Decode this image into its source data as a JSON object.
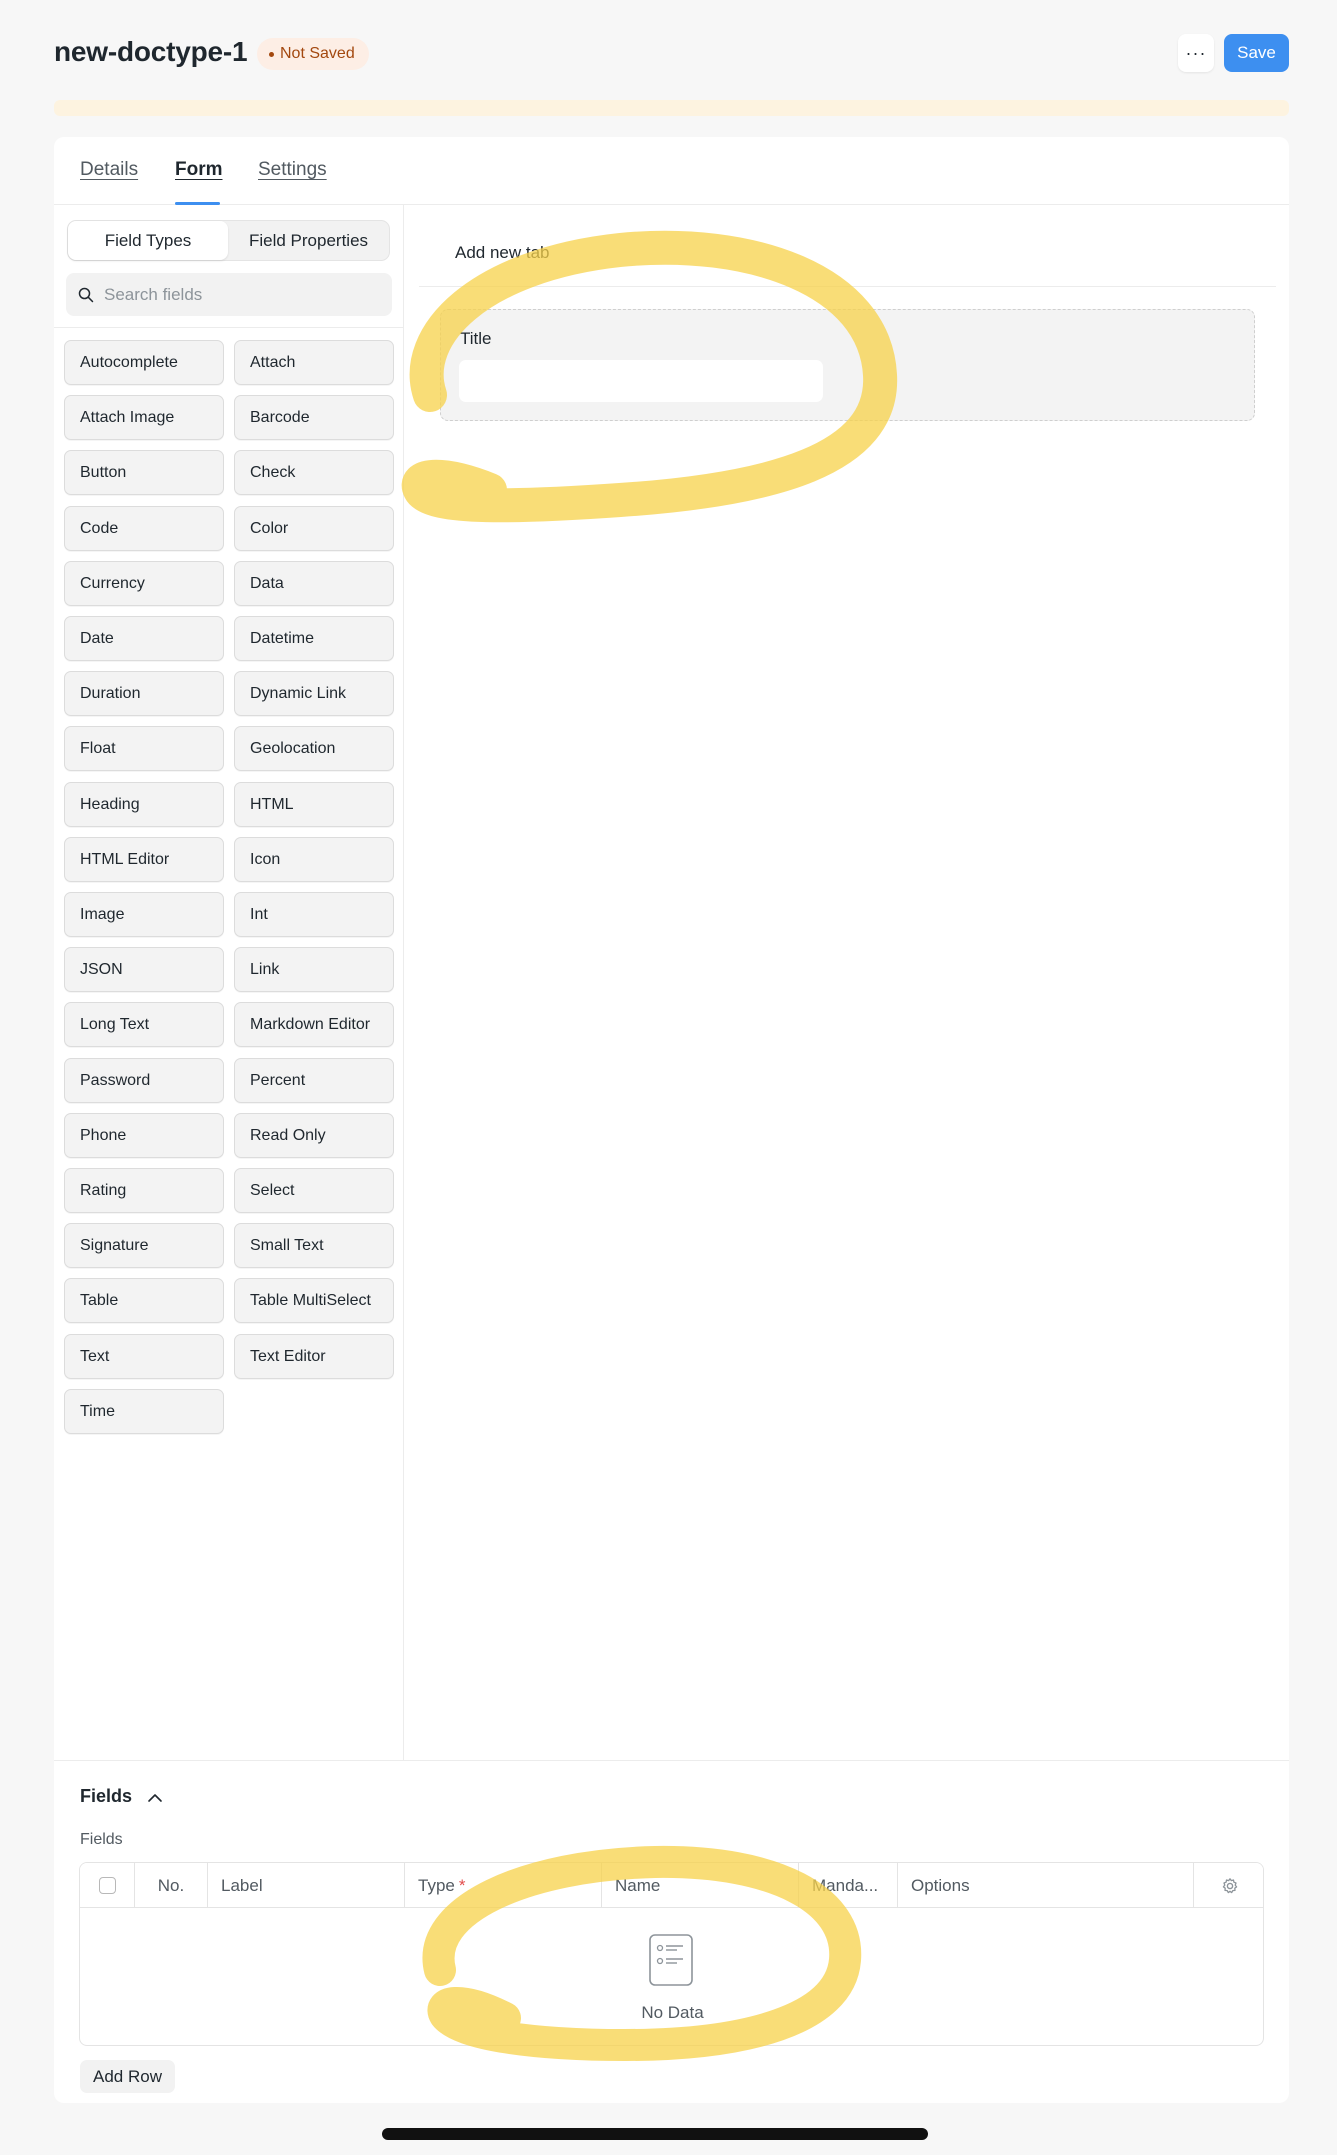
{
  "header": {
    "title": "new-doctype-1",
    "status": "Not Saved",
    "more_label": "···",
    "save_label": "Save"
  },
  "tabs": [
    {
      "label": "Details"
    },
    {
      "label": "Form",
      "active": true
    },
    {
      "label": "Settings"
    }
  ],
  "sidebar": {
    "segment_left": "Field Types",
    "segment_right": "Field Properties",
    "search_placeholder": "Search fields",
    "field_types": [
      "Autocomplete",
      "Attach",
      "Attach Image",
      "Barcode",
      "Button",
      "Check",
      "Code",
      "Color",
      "Currency",
      "Data",
      "Date",
      "Datetime",
      "Duration",
      "Dynamic Link",
      "Float",
      "Geolocation",
      "Heading",
      "HTML",
      "HTML Editor",
      "Icon",
      "Image",
      "Int",
      "JSON",
      "Link",
      "Long Text",
      "Markdown Editor",
      "Password",
      "Percent",
      "Phone",
      "Read Only",
      "Rating",
      "Select",
      "Signature",
      "Small Text",
      "Table",
      "Table MultiSelect",
      "Text",
      "Text Editor",
      "Time"
    ]
  },
  "canvas": {
    "add_tab_label": "Add new tab",
    "field_label": "Title"
  },
  "fields_section": {
    "title": "Fields",
    "subtitle": "Fields",
    "columns": [
      "No.",
      "Label",
      "Type",
      "Name",
      "Manda...",
      "Options"
    ],
    "type_required_mark": "*",
    "empty_text": "No Data",
    "add_row_label": "Add Row"
  },
  "colors": {
    "accent": "#3d8ff0",
    "badge_bg": "#fdeee5",
    "badge_text": "#a3480f",
    "highlight": "#f7d24a"
  }
}
